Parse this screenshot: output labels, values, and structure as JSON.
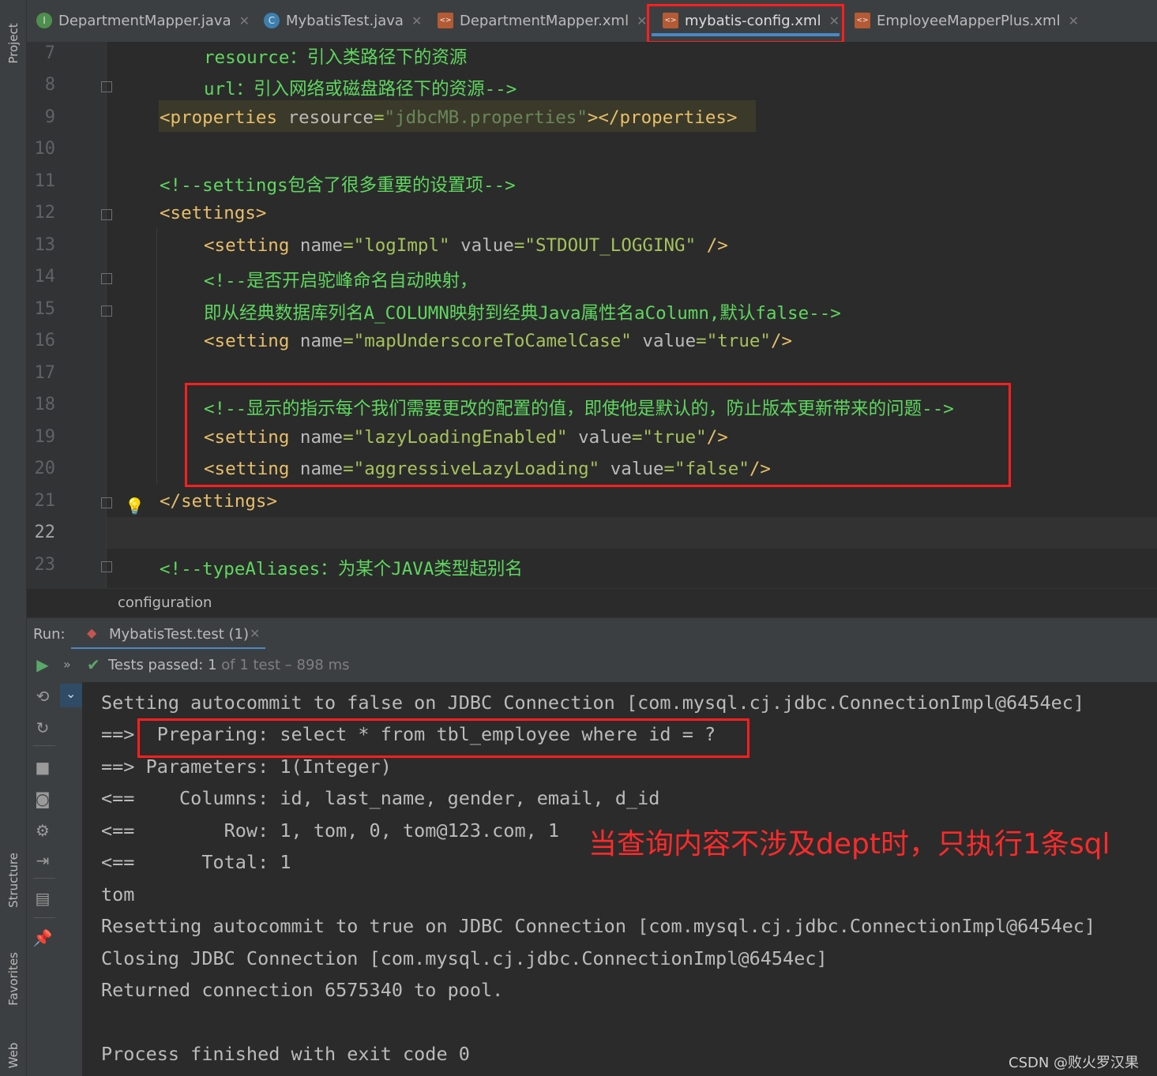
{
  "left_strip": {
    "project_label": "Project",
    "structure_label": "Structure",
    "favorites_label": "Favorites",
    "web_label": "Web"
  },
  "tabs": [
    {
      "label": "DepartmentMapper.java",
      "icon": "interface-icon",
      "active": false
    },
    {
      "label": "MybatisTest.java",
      "icon": "class-icon",
      "active": false
    },
    {
      "label": "DepartmentMapper.xml",
      "icon": "xml-file-icon",
      "active": false
    },
    {
      "label": "mybatis-config.xml",
      "icon": "xml-file-icon",
      "active": true
    },
    {
      "label": "EmployeeMapperPlus.xml",
      "icon": "xml-file-icon",
      "active": false
    }
  ],
  "editor": {
    "line_numbers": [
      "7",
      "8",
      "9",
      "10",
      "11",
      "12",
      "13",
      "14",
      "15",
      "16",
      "17",
      "18",
      "19",
      "20",
      "21",
      "22",
      "23"
    ],
    "current_line": "22",
    "lines": {
      "l7": "resource：引入类路径下的资源",
      "l8": "url：引入网络或磁盘路径下的资源-->",
      "l9_open": "<properties",
      "l9_attr": " resource",
      "l9_eq": "=",
      "l9_val": "\"jdbcMB.properties\"",
      "l9_close": "></properties>",
      "l11": "<!--settings包含了很多重要的设置项-->",
      "l12": "<settings>",
      "l13_tag": "<setting",
      "l13_name_attr": " name",
      "l13_name_val": "\"logImpl\"",
      "l13_value_attr": " value",
      "l13_value_val": "\"STDOUT_LOGGING\"",
      "l13_end": " />",
      "l14": "<!--是否开启驼峰命名自动映射，",
      "l15": "即从经典数据库列名A_COLUMN映射到经典Java属性名aColumn,默认false-->",
      "l16_tag": "<setting",
      "l16_name_attr": " name",
      "l16_name_val": "\"mapUnderscoreToCamelCase\"",
      "l16_value_attr": " value",
      "l16_value_val": "\"true\"",
      "l16_end": "/>",
      "l18": "<!--显示的指示每个我们需要更改的配置的值，即使他是默认的，防止版本更新带来的问题-->",
      "l19_tag": "<setting",
      "l19_name_attr": " name",
      "l19_name_val": "\"lazyLoadingEnabled\"",
      "l19_value_attr": " value",
      "l19_value_val": "\"true\"",
      "l19_end": "/>",
      "l20_tag": "<setting",
      "l20_name_attr": " name",
      "l20_name_val": "\"aggressiveLazyLoading\"",
      "l20_value_attr": " value",
      "l20_value_val": "\"false\"",
      "l20_end": "/>",
      "l21": "</settings>",
      "l23": "<!--typeAliases：为某个JAVA类型起别名"
    }
  },
  "breadcrumb": "configuration",
  "run": {
    "label": "Run:",
    "tab": "MybatisTest.test (1)",
    "tests_passed_label": "Tests passed:",
    "tests_passed_count": "1",
    "tests_of": "of 1 test – 898 ms"
  },
  "console": [
    "Setting autocommit to false on JDBC Connection [com.mysql.cj.jdbc.ConnectionImpl@6454ec]",
    "==>  Preparing: select * from tbl_employee where id = ?",
    "==> Parameters: 1(Integer)",
    "<==    Columns: id, last_name, gender, email, d_id",
    "<==        Row: 1, tom, 0, tom@123.com, 1",
    "<==      Total: 1",
    "tom",
    "Resetting autocommit to true on JDBC Connection [com.mysql.cj.jdbc.ConnectionImpl@6454ec]",
    "Closing JDBC Connection [com.mysql.cj.jdbc.ConnectionImpl@6454ec]",
    "Returned connection 6575340 to pool.",
    "",
    "Process finished with exit code 0"
  ],
  "annotation": "当查询内容不涉及dept时，只执行1条sql",
  "watermark": "CSDN @败火罗汉果",
  "colors": {
    "highlight_box": "#ff1f1f",
    "comment_green": "#5fd75f",
    "tag_yellow": "#e8bf6a",
    "string_green": "#a5c25c",
    "active_tab_underline": "#4a88c7"
  }
}
